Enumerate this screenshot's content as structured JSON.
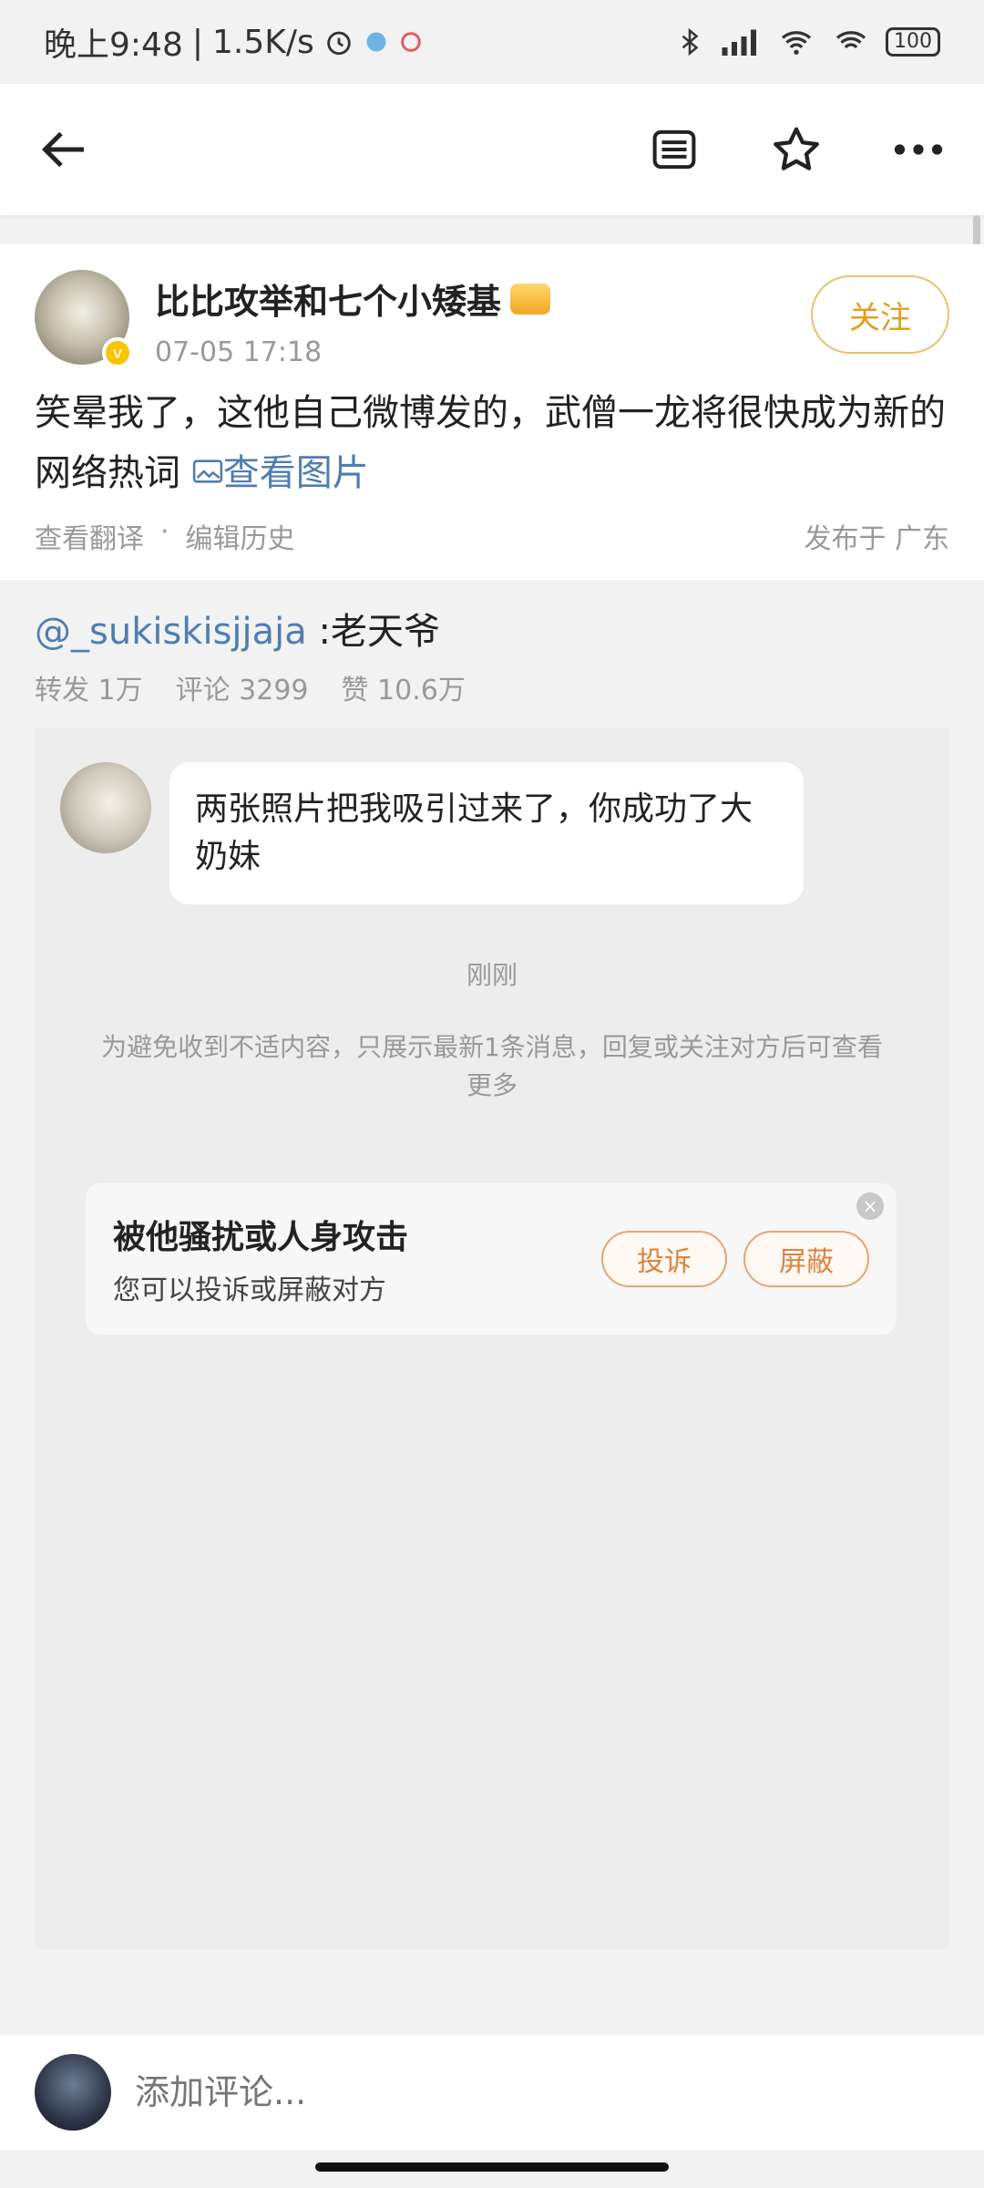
{
  "status_bar": {
    "time": "晚上9:48",
    "speed": "1.5K/s",
    "battery": "100"
  },
  "nav": {
    "back_icon": "back-arrow-icon",
    "list_icon": "list-icon",
    "star_icon": "star-icon",
    "more_icon": "more-icon"
  },
  "post": {
    "author": "比比攻举和七个小矮基",
    "time": "07-05 17:18",
    "follow_label": "关注",
    "text": "笑晕我了，这他自己微博发的，武僧一龙将很快成为新的网络热词",
    "picture_link": "查看图片",
    "translate": "查看翻译",
    "separator": "·",
    "edit_history": "编辑历史",
    "location": "发布于 广东"
  },
  "repost": {
    "mention": "@_sukiskisjjaja",
    "text": " :老天爷",
    "reposts": "转发 1万",
    "comments": "评论 3299",
    "likes": "赞 10.6万"
  },
  "screenshot": {
    "message": "两张照片把我吸引过来了，你成功了大奶妹",
    "time": "刚刚",
    "notice": "为避免收到不适内容，只展示最新1条消息，回复或关注对方后可查看更多",
    "harass_title": "被他骚扰或人身攻击",
    "harass_sub": "您可以投诉或屏蔽对方",
    "report_label": "投诉",
    "block_label": "屏蔽",
    "close_symbol": "×"
  },
  "comment_bar": {
    "placeholder": "添加评论..."
  },
  "colors": {
    "link": "#507daf",
    "follow": "#e0a021",
    "action": "#e0833c"
  }
}
